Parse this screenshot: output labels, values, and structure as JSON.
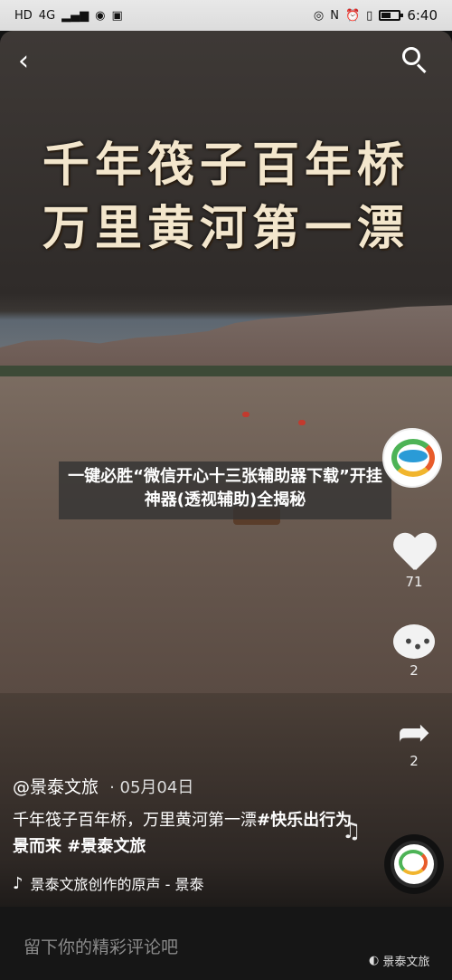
{
  "status_bar": {
    "network": "4G",
    "time": "6:40",
    "battery_level": 0.55
  },
  "video": {
    "title_line1": "千年筏子百年桥",
    "title_line2": "万里黄河第一漂"
  },
  "overlay_banner": {
    "text": "一键必胜“微信开心十三张辅助器下载”开挂神器(透视辅助)全揭秘"
  },
  "actions": {
    "likes": "71",
    "comments": "2",
    "shares": "2"
  },
  "caption": {
    "author": "@景泰文旅",
    "date": "· 05月04日",
    "text_plain": "千年筏子百年桥，万里黄河第一漂",
    "text_tags": "#快乐出行为景而来 #景泰文旅",
    "music": "景泰文旅创作的原声 - 景泰"
  },
  "bottom": {
    "comment_placeholder": "留下你的精彩评论吧",
    "watermark": "景泰文旅"
  },
  "colors": {
    "logo_green": "#4db356",
    "logo_orange": "#e85b2a",
    "logo_blue": "#2a9bd7",
    "logo_yellow": "#f1b52e"
  }
}
